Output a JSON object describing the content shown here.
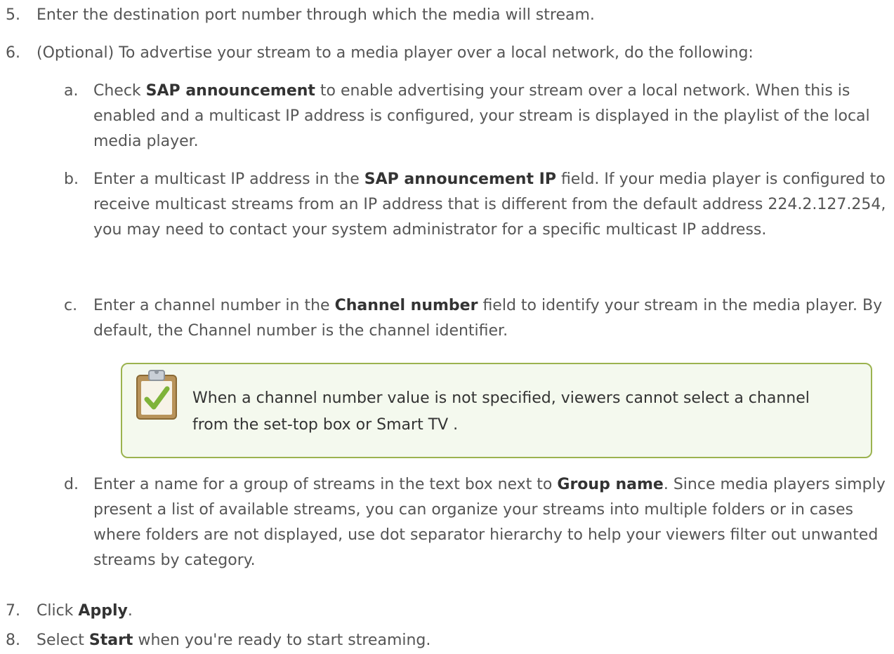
{
  "steps": [
    {
      "num": "5.",
      "text": "Enter the destination port number through which the media will stream."
    },
    {
      "num": "6.",
      "text": "(Optional) To advertise your stream to a media player over a local network, do the following:"
    },
    {
      "num": "7.",
      "pre": "Click ",
      "bold": "Apply",
      "post": "."
    },
    {
      "num": "8.",
      "pre": "Select ",
      "bold": "Start",
      "post": " when you're ready to start streaming."
    }
  ],
  "substeps": [
    {
      "num": "a.",
      "pre": "Check ",
      "bold": "SAP announcement",
      "post": " to enable advertising your stream over a local network. When this is enabled and a multicast IP address is configured, your stream is displayed in the playlist of the local media player."
    },
    {
      "num": "b.",
      "pre": "Enter a multicast IP address in the ",
      "bold": "SAP announcement IP",
      "post": " field. If your media player is configured to receive multicast streams from an IP address that is different from the default address 224.2.127.254, you may need to contact your system administrator for a specific multicast IP address."
    },
    {
      "num": "c.",
      "pre": "Enter a channel number in the ",
      "bold": "Channel number",
      "post": " field to identify your stream in the media player. By default, the Channel number is the channel identifier."
    },
    {
      "num": "d.",
      "pre": "Enter a name for a group of streams in the text box next to ",
      "bold": "Group name",
      "post": ". Since media players simply present a list of available streams, you can organize your streams into multiple folders or in cases where folders are not displayed, use dot separator hierarchy to help your viewers filter out unwanted streams by category."
    }
  ],
  "note": {
    "icon": "clipboard-check-icon",
    "text": "When a channel number value is not specified, viewers cannot select a channel from the set-top box or Smart TV ."
  },
  "colors": {
    "body_text": "#555555",
    "bold_text": "#333333",
    "note_border": "#9bb34f",
    "note_bg": "#f4f9ee"
  }
}
